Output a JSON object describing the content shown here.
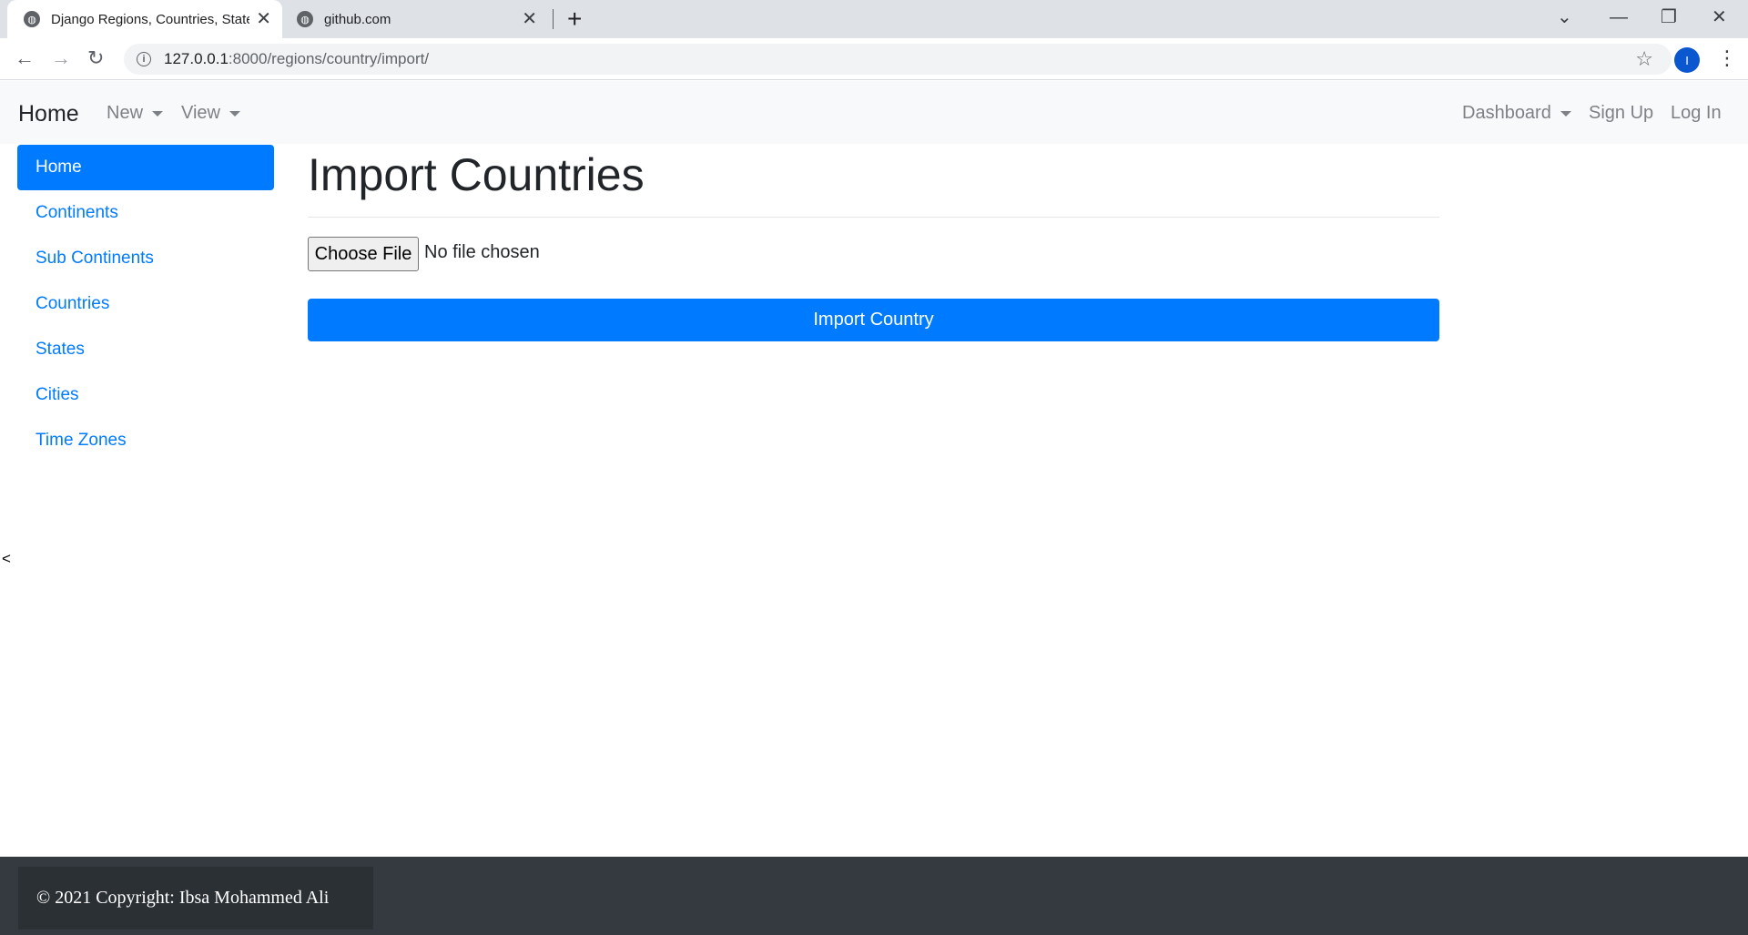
{
  "browser": {
    "tabs": [
      {
        "title": "Django Regions, Countries, States",
        "active": true
      },
      {
        "title": "github.com",
        "active": false
      }
    ],
    "url_host": "127.0.0.1",
    "url_path": ":8000/regions/country/import/",
    "profile_initial": "I",
    "icons": {
      "globe": "globe-icon",
      "close": "close-icon",
      "new_tab": "plus-icon",
      "back": "back-arrow-icon",
      "forward": "forward-arrow-icon",
      "reload": "reload-icon",
      "info": "info-icon",
      "star": "star-icon",
      "menu": "kebab-menu-icon"
    }
  },
  "navbar": {
    "brand": "Home",
    "left_menus": [
      "New",
      "View"
    ],
    "dashboard": "Dashboard",
    "signup": "Sign Up",
    "login": "Log In"
  },
  "sidebar": {
    "items": [
      {
        "label": "Home",
        "active": true
      },
      {
        "label": "Continents"
      },
      {
        "label": "Sub Continents"
      },
      {
        "label": "Countries"
      },
      {
        "label": "States"
      },
      {
        "label": "Cities"
      },
      {
        "label": "Time Zones"
      }
    ],
    "collapse_toggle": "<"
  },
  "main": {
    "title": "Import Countries",
    "file_button": "Choose File",
    "file_status": "No file chosen",
    "submit": "Import Country"
  },
  "footer": {
    "copyright": "© 2021 Copyright: Ibsa Mohammed Ali"
  },
  "colors": {
    "primary": "#007bff",
    "navbar_bg": "#f8f9fa",
    "footer_bg": "#343a40"
  }
}
